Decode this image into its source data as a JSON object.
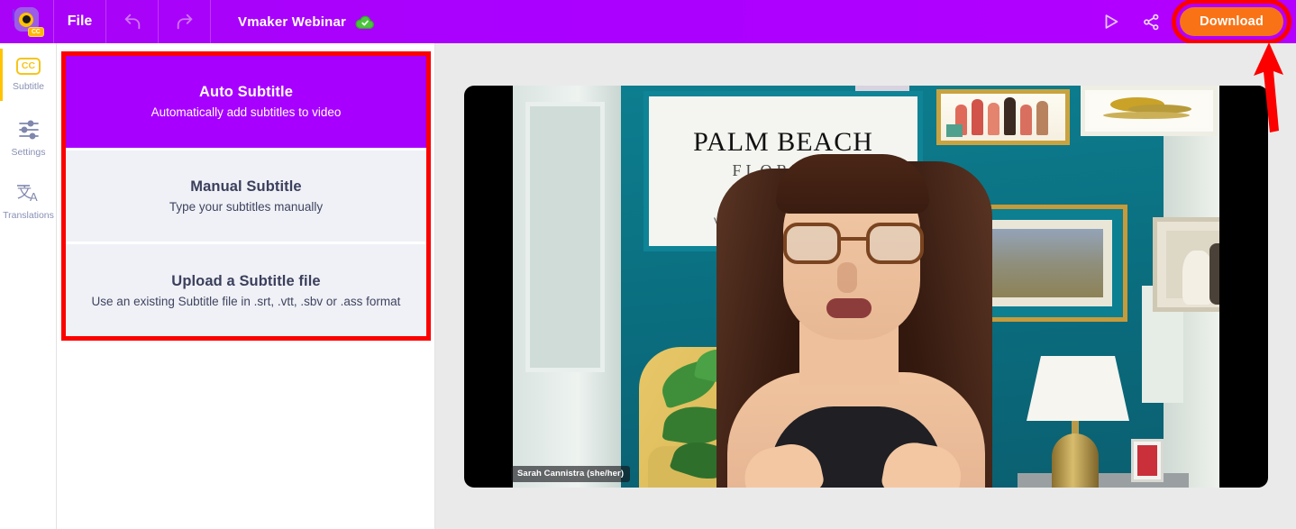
{
  "topbar": {
    "logo_icon": "vmaker-cc-logo-icon",
    "file_menu": "File",
    "undo_icon": "undo-arrow-icon",
    "redo_icon": "redo-arrow-icon",
    "project_title": "Vmaker Webinar",
    "save_status_icon": "cloud-saved-check-icon",
    "preview_icon": "play-preview-icon",
    "share_icon": "share-nodes-icon",
    "download_label": "Download",
    "colors": {
      "bar_purple": "#aa00ff",
      "download_orange": "#f97316",
      "highlight_red": "#fc0000",
      "saved_green": "#3dbb34"
    }
  },
  "annotation": {
    "arrow_icon": "red-up-arrow-annotation",
    "arrow_color": "#fc0000",
    "highlight_box_color": "#fc0000"
  },
  "sidebar": {
    "items": [
      {
        "label": "Subtitle",
        "icon": "cc-subtitle-icon",
        "active": true
      },
      {
        "label": "Settings",
        "icon": "sliders-settings-icon",
        "active": false
      },
      {
        "label": "Translations",
        "icon": "translate-language-icon",
        "active": false
      }
    ],
    "active_indicator_color": "#ffc300"
  },
  "panel": {
    "options": [
      {
        "title": "Auto Subtitle",
        "desc": "Automatically add subtitles to video",
        "selected": true
      },
      {
        "title": "Manual Subtitle",
        "desc": "Type your subtitles manually",
        "selected": false
      },
      {
        "title": "Upload a Subtitle file",
        "desc": "Use an existing Subtitle file in .srt, .vtt, .sbv or .ass format",
        "selected": false
      }
    ]
  },
  "video": {
    "participant_name": "Sarah Cannistra (she/her)",
    "scene": {
      "wall_sign_line1": "PALM BEACH",
      "wall_sign_line2": "FLORIDA",
      "wall_color": "#0d7f90"
    }
  }
}
